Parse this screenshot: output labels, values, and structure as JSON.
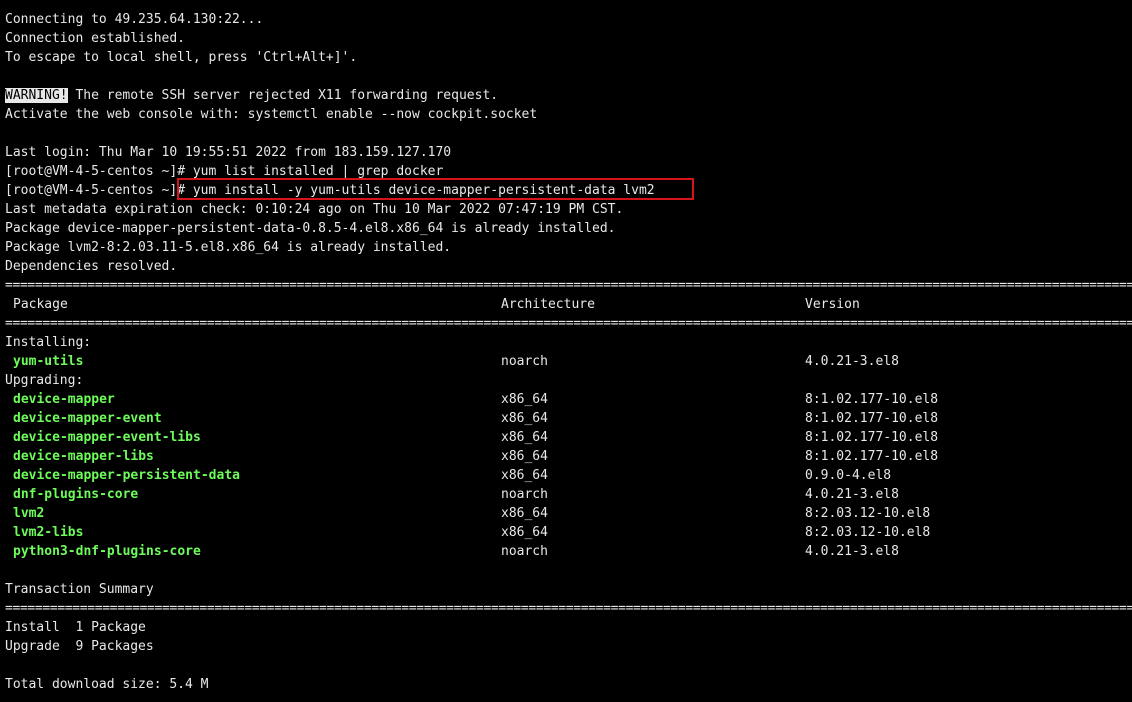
{
  "session": {
    "connecting": "Connecting to 49.235.64.130:22...",
    "established": "Connection established.",
    "escape_hint": "To escape to local shell, press 'Ctrl+Alt+]'."
  },
  "warning": {
    "badge": "WARNING!",
    "text": " The remote SSH server rejected X11 forwarding request.",
    "activate": "Activate the web console with: systemctl enable --now cockpit.socket"
  },
  "login": {
    "last_login": "Last login: Thu Mar 10 19:55:51 2022 from 183.159.127.170",
    "prompt": "[root@VM-4-5-centos ~]",
    "command_1": "# yum list installed | grep docker",
    "command_2": "# yum install -y yum-utils device-mapper-persistent-data lvm2"
  },
  "output": {
    "metadata": "Last metadata expiration check: 0:10:24 ago on Thu 10 Mar 2022 07:47:19 PM CST.",
    "installed_1": "Package device-mapper-persistent-data-0.8.5-4.el8.x86_64 is already installed.",
    "installed_2": "Package lvm2-8:2.03.11-5.el8.x86_64 is already installed.",
    "deps": "Dependencies resolved."
  },
  "separator": "====================================================================================================================================================================================",
  "table": {
    "headers": {
      "package": "Package",
      "arch": "Architecture",
      "version": "Version"
    },
    "installing_label": "Installing:",
    "installing": [
      {
        "name": "yum-utils",
        "arch": "noarch",
        "version": "4.0.21-3.el8"
      }
    ],
    "upgrading_label": "Upgrading:",
    "upgrading": [
      {
        "name": "device-mapper",
        "arch": "x86_64",
        "version": "8:1.02.177-10.el8"
      },
      {
        "name": "device-mapper-event",
        "arch": "x86_64",
        "version": "8:1.02.177-10.el8"
      },
      {
        "name": "device-mapper-event-libs",
        "arch": "x86_64",
        "version": "8:1.02.177-10.el8"
      },
      {
        "name": "device-mapper-libs",
        "arch": "x86_64",
        "version": "8:1.02.177-10.el8"
      },
      {
        "name": "device-mapper-persistent-data",
        "arch": "x86_64",
        "version": "0.9.0-4.el8"
      },
      {
        "name": "dnf-plugins-core",
        "arch": "noarch",
        "version": "4.0.21-3.el8"
      },
      {
        "name": "lvm2",
        "arch": "x86_64",
        "version": "8:2.03.12-10.el8"
      },
      {
        "name": "lvm2-libs",
        "arch": "x86_64",
        "version": "8:2.03.12-10.el8"
      },
      {
        "name": "python3-dnf-plugins-core",
        "arch": "noarch",
        "version": "4.0.21-3.el8"
      }
    ]
  },
  "summary": {
    "title": "Transaction Summary",
    "install": "Install  1 Package",
    "upgrade": "Upgrade  9 Packages",
    "download": "Total download size: 5.4 M"
  },
  "colors": {
    "background": "#000000",
    "text": "#e8e8e8",
    "package_name": "#6dfc5a",
    "highlight_box": "#d8141b"
  }
}
